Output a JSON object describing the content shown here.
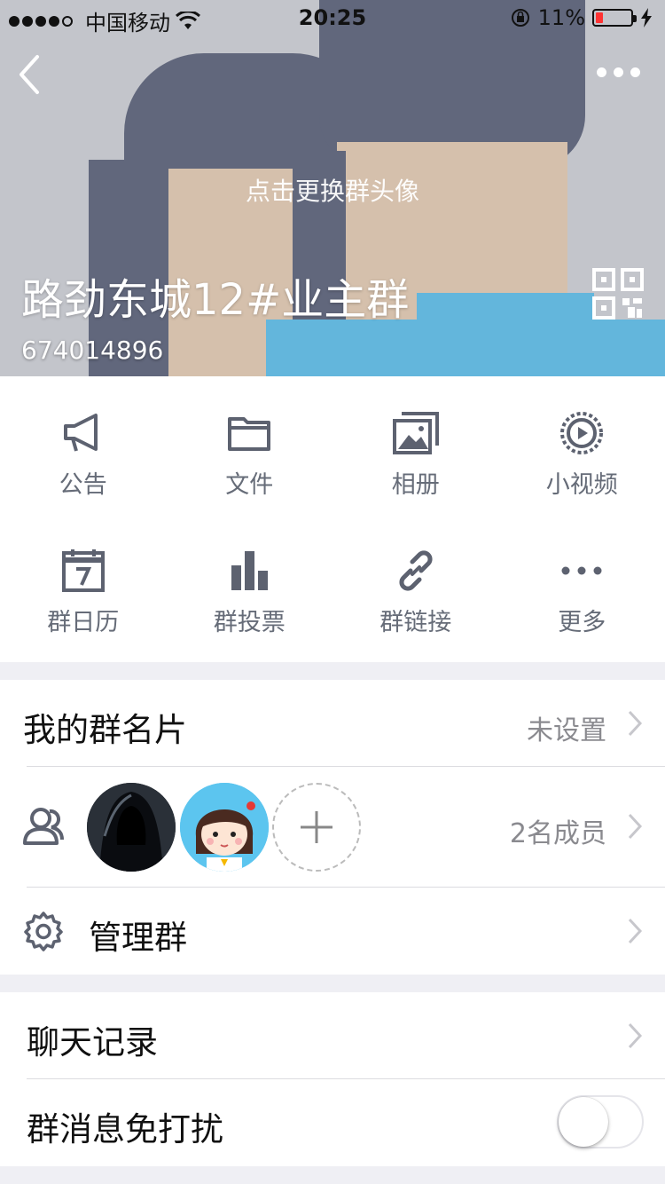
{
  "status_bar": {
    "carrier": "中国移动",
    "time": "20:25",
    "battery": "11%",
    "battery_level": 0.11
  },
  "header": {
    "change_avatar_hint": "点击更换群头像",
    "group_name": "路劲东城12#业主群",
    "group_id": "674014896",
    "back_icon": "chevron-left-icon",
    "more_icon": "more-dots-icon",
    "qr_icon": "qr-code-icon"
  },
  "features": [
    {
      "label": "公告",
      "icon": "megaphone-icon"
    },
    {
      "label": "文件",
      "icon": "folder-icon"
    },
    {
      "label": "相册",
      "icon": "photo-album-icon"
    },
    {
      "label": "小视频",
      "icon": "video-play-icon"
    },
    {
      "label": "群日历",
      "icon": "calendar-icon"
    },
    {
      "label": "群投票",
      "icon": "bar-chart-icon"
    },
    {
      "label": "群链接",
      "icon": "link-icon"
    },
    {
      "label": "更多",
      "icon": "more-dots-icon"
    }
  ],
  "group_card": {
    "label": "我的群名片",
    "value": "未设置"
  },
  "members": {
    "count_label": "2名成员",
    "icon": "members-icon"
  },
  "manage": {
    "label": "管理群",
    "icon": "gear-icon"
  },
  "chat_history": {
    "label": "聊天记录"
  },
  "do_not_disturb": {
    "label": "群消息免打扰",
    "enabled": false
  },
  "colors": {
    "icon_gray": "#5d6270",
    "accent_blue": "#3ab6e8",
    "low_battery": "#ff3b30"
  }
}
